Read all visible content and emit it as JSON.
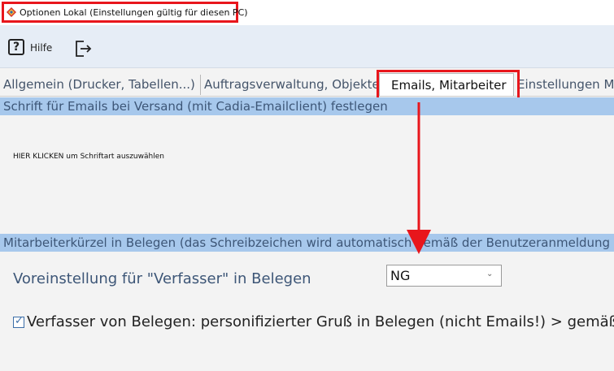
{
  "window": {
    "title": "Optionen Lokal (Einstellungen gültig für diesen PC)"
  },
  "toolbar": {
    "help_label": "Hilfe",
    "help_glyph": "?"
  },
  "tabs": [
    {
      "label": "Allgemein (Drucker, Tabellen...)"
    },
    {
      "label": "Auftragsverwaltung, Objekte"
    },
    {
      "label": "Emails, Mitarbeiter"
    },
    {
      "label": "Einstellungen Mo"
    }
  ],
  "sections": {
    "font": {
      "header": "Schrift für Emails bei Versand (mit Cadia-Emailclient) festlegen",
      "hint": "HIER KLICKEN um Schriftart auszuwählen"
    },
    "kuerzel": {
      "header": "Mitarbeiterkürzel in Belegen (das Schreibzeichen wird automatisch gemäß der Benutzeranmeldung",
      "voreinstellung_label": "Voreinstellung für \"Verfasser\" in Belegen",
      "verfasser_value": "NG",
      "checkbox_label": "Verfasser von Belegen: personifizierter Gruß in Belegen (nicht Emails!) > gemäß Mita",
      "checkbox_checked": true
    }
  },
  "colors": {
    "annotation": "#e8161c",
    "section_header_bg": "#a7c8ec"
  },
  "icons": {
    "app": "app-logo-icon",
    "help": "help-icon",
    "exit": "exit-icon",
    "chevron": "chevron-down-icon",
    "check": "checkmark-icon"
  }
}
